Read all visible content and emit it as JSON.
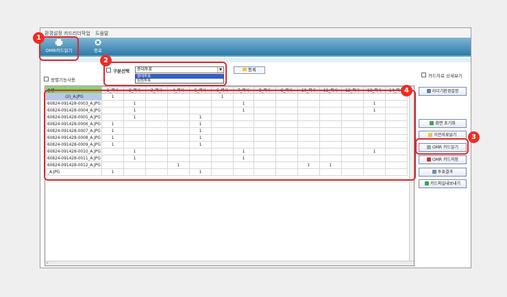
{
  "menu": {
    "items": [
      "환경설정",
      "카드리더작업",
      "도움말"
    ]
  },
  "toolbar": {
    "omr_read_label": "OMR카드읽기",
    "exit_label": "종료"
  },
  "options": {
    "regular_feature_label": "정렬기능사용",
    "show_card_detail_label": "카드자료 상세보기",
    "category_label": "구분선택",
    "category_value": "중대투표",
    "category_options": [
      "중대투표",
      "임원투표"
    ],
    "register_label": "등록"
  },
  "grid": {
    "corner_label": "순번",
    "columns": [
      "1_목사",
      "2_목사",
      "3_목사",
      "4_목사",
      "5_목사",
      "6_목사",
      "7_목사",
      "8_목사",
      "9_목사",
      "10_목사",
      "11_목사",
      "12_목사",
      "13_목사",
      "14_목사"
    ],
    "rows": [
      {
        "file": "(2)_A.JPG",
        "cells": [
          "1",
          "",
          "",
          "",
          "",
          "1",
          "",
          "",
          "",
          "",
          "",
          "",
          "",
          ""
        ]
      },
      {
        "file": "60824-091428-0003_A.JPG",
        "cells": [
          "",
          "1",
          "",
          "",
          "",
          "",
          "1",
          "",
          "",
          "",
          "",
          "",
          "1",
          ""
        ]
      },
      {
        "file": "60824-091428-0004_A.JPG",
        "cells": [
          "",
          "1",
          "",
          "",
          "",
          "",
          "1",
          "",
          "",
          "",
          "",
          "",
          "1",
          ""
        ]
      },
      {
        "file": "60824-091428-0005_A.JPG",
        "cells": [
          "",
          "1",
          "",
          "",
          "1",
          "",
          "",
          "",
          "",
          "",
          "",
          "",
          "",
          ""
        ]
      },
      {
        "file": "60824-091428-0006_A.JPG",
        "cells": [
          "1",
          "",
          "",
          "",
          "1",
          "",
          "",
          "",
          "",
          "",
          "",
          "",
          "",
          ""
        ]
      },
      {
        "file": "60824-091428-0007_A.JPG",
        "cells": [
          "1",
          "",
          "",
          "",
          "1",
          "",
          "",
          "",
          "",
          "",
          "",
          "",
          "",
          ""
        ]
      },
      {
        "file": "60824-091428-0008_A.JPG",
        "cells": [
          "1",
          "",
          "",
          "",
          "1",
          "",
          "",
          "",
          "",
          "",
          "",
          "",
          "",
          ""
        ]
      },
      {
        "file": "60824-091428-0009_A.JPG",
        "cells": [
          "1",
          "",
          "",
          "",
          "1",
          "",
          "",
          "",
          "",
          "",
          "",
          "",
          "",
          ""
        ]
      },
      {
        "file": "60824-091428-0010_A.JPG",
        "cells": [
          "",
          "1",
          "",
          "",
          "",
          "",
          "1",
          "",
          "",
          "",
          "",
          "",
          "1",
          ""
        ]
      },
      {
        "file": "60824-091428-0011_A.JPG",
        "cells": [
          "",
          "1",
          "",
          "",
          "",
          "",
          "1",
          "",
          "",
          "",
          "",
          "",
          "",
          ""
        ]
      },
      {
        "file": "60824-091428-0012_A.JPG",
        "cells": [
          "",
          "",
          "",
          "1",
          "",
          "",
          "",
          "",
          "",
          "1",
          "1",
          "",
          "",
          ""
        ]
      },
      {
        "file": "_A.JPG",
        "cells": [
          "1",
          "",
          "",
          "",
          "1",
          "",
          "",
          "",
          "",
          "",
          "",
          "",
          "",
          ""
        ]
      }
    ]
  },
  "side_buttons": {
    "reader_env": "리더기환경설정",
    "screen_reset": "화면 초기화",
    "prev_data": "이전자료읽기",
    "omr_read": "OMR 카드읽기",
    "omr_save": "OMR 카드저장",
    "vote_result": "투표결과",
    "export": "카드파일내보내기"
  },
  "badges": [
    "1",
    "2",
    "3",
    "4"
  ],
  "colors": {
    "highlight": "#e3232a",
    "toolbar": "#2e7aa9",
    "header_green": "#7cd66c"
  }
}
